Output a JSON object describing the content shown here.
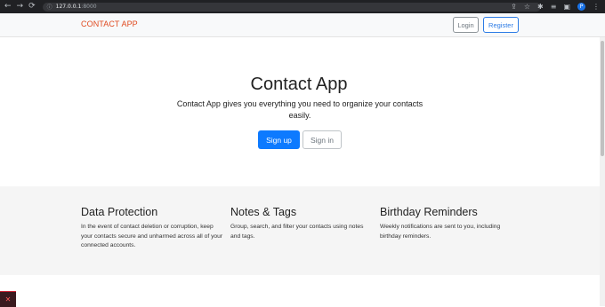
{
  "browser": {
    "url_host": "127.0.0.1",
    "url_port": ":8000",
    "profile_initial": "P"
  },
  "navbar": {
    "brand": "CONTACT APP",
    "login_label": "Login",
    "register_label": "Register"
  },
  "hero": {
    "title": "Contact App",
    "subtitle": "Contact App gives you everything you need to organize your contacts easily.",
    "signup_label": "Sign up",
    "signin_label": "Sign in"
  },
  "features": [
    {
      "title": "Data Protection",
      "text": "In the event of contact deletion or corruption, keep your contacts secure and unharmed across all of your connected accounts."
    },
    {
      "title": "Notes & Tags",
      "text": "Group, search, and filter your contacts using notes and tags."
    },
    {
      "title": "Birthday Reminders",
      "text": "Weekly notifications are sent to you, including birthday reminders."
    }
  ],
  "colors": {
    "brand": "#e04a1f",
    "primary": "#0d7aff",
    "feature_bg": "#f5f5f5"
  }
}
